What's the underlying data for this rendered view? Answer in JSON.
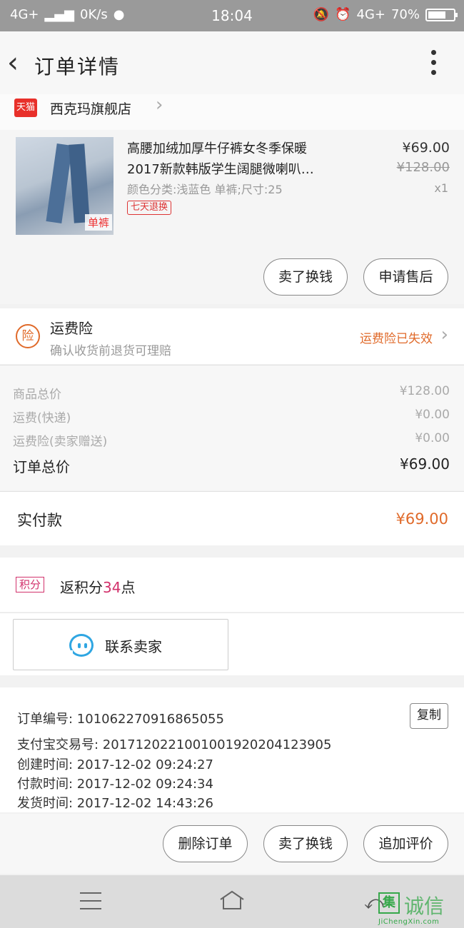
{
  "status_bar": {
    "network_left": "4G+",
    "speed": "0K/s",
    "time": "18:04",
    "network_right": "4G+",
    "battery_text": "70%",
    "battery_level": 0.7
  },
  "header": {
    "title": "订单详情"
  },
  "shop": {
    "platform_badge": "天猫",
    "name": "西克玛旗舰店"
  },
  "product": {
    "title_line1": "高腰加绒加厚牛仔裤女冬季保暖",
    "title_line2": "2017新款韩版学生阔腿微喇叭…",
    "spec": "颜色分类:浅蓝色 单裤;尺寸:25",
    "badge": "七天退换",
    "thumb_tag": "单裤",
    "price": "¥69.00",
    "original_price": "¥128.00",
    "quantity": "x1",
    "buttons": [
      "卖了换钱",
      "申请售后"
    ]
  },
  "insurance": {
    "icon_text": "险",
    "title": "运费险",
    "subtitle": "确认收货前退货可理赔",
    "status": "运费险已失效"
  },
  "costs": {
    "items": [
      {
        "label": "商品总价",
        "value": "¥128.00"
      },
      {
        "label": "运费(快递)",
        "value": "¥0.00"
      },
      {
        "label": "运费险(卖家赠送)",
        "value": "¥0.00"
      }
    ],
    "total_label": "订单总价",
    "total_value": "¥69.00"
  },
  "payment": {
    "label": "实付款",
    "value": "¥69.00"
  },
  "points": {
    "badge": "积分",
    "text_prefix": "返积分",
    "amount": "34",
    "text_suffix": "点"
  },
  "contact": {
    "label": "联系卖家"
  },
  "order_info": {
    "order_no": "订单编号: 101062270916865055",
    "alipay_no": "支付宝交易号: 2017120221001001920204123905",
    "created": "创建时间: 2017-12-02 09:24:27",
    "paid": "付款时间: 2017-12-02 09:24:34",
    "shipped": "发货时间: 2017-12-02 14:43:26",
    "copy_label": "复制"
  },
  "bottom_actions": [
    "删除订单",
    "卖了换钱",
    "追加评价"
  ],
  "watermark": {
    "cn": "诚信",
    "box": "集",
    "en": "JiChengXin.com"
  }
}
